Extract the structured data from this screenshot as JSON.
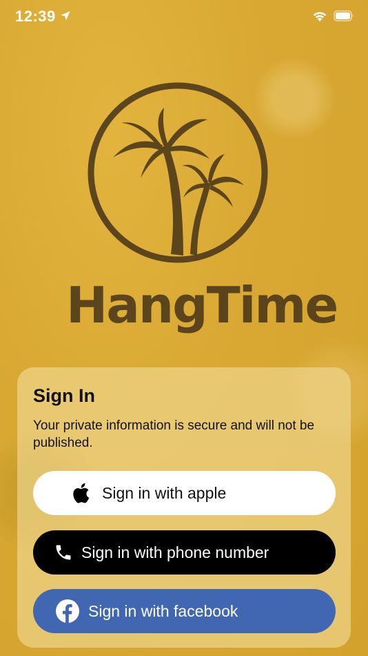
{
  "status_bar": {
    "time": "12:39"
  },
  "brand": {
    "name": "HangTime"
  },
  "sign_in": {
    "title": "Sign In",
    "subtitle": "Your private information is secure and will not be published.",
    "apple_label": "Sign in with apple",
    "phone_label": "Sign in with phone number",
    "facebook_label": "Sign in with facebook"
  },
  "colors": {
    "background": "#d9a933",
    "logo": "#4e3a1a",
    "facebook": "#4267b2",
    "phone_button": "#000000",
    "apple_button": "#ffffff"
  },
  "icons": {
    "location": "location-arrow-icon",
    "wifi": "wifi-icon",
    "battery": "battery-icon",
    "apple": "apple-icon",
    "phone": "phone-icon",
    "facebook": "facebook-icon",
    "palm": "palm-tree-icon"
  }
}
